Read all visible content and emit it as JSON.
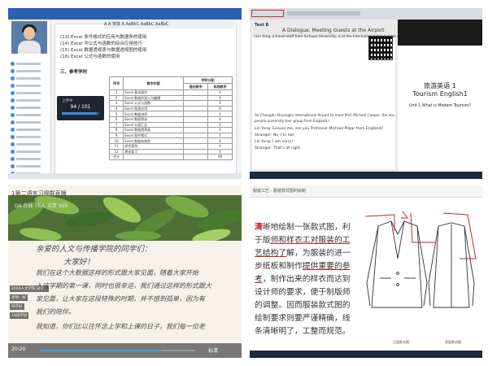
{
  "q1": {
    "ribbon": "A A 宋体 A AaBbC AaBbC AaBbC",
    "list": [
      "(13) Excel 条件格式的应用与数据条的使用",
      "(14) Excel 中公式与函数的综合应用技巧",
      "(15) Excel 数据透视表与数据透视图的使用",
      "(16) Excel 公式与函数的使用"
    ],
    "table_title": "三、参考学时",
    "table_headers": [
      "序号",
      "教学内容",
      "学时分配",
      "理论教学",
      "实践教学"
    ],
    "table_rows": [
      [
        "1",
        "Excel 基本操作",
        "",
        "4"
      ],
      [
        "2",
        "Excel 数据的录入与编辑",
        "",
        "4"
      ],
      [
        "3",
        "Excel 公式与函数",
        "",
        "4"
      ],
      [
        "4",
        "Excel 图表应用",
        "",
        "4"
      ],
      [
        "5",
        "Excel 数据排序",
        "",
        "4"
      ],
      [
        "6",
        "Excel 数据筛选",
        "",
        "4"
      ],
      [
        "7",
        "Excel 分类汇总",
        "",
        "4"
      ],
      [
        "8",
        "Excel 数据透视表",
        "",
        "4"
      ],
      [
        "9",
        "Excel 条件格式",
        "",
        "4"
      ],
      [
        "10",
        "Excel 数据有效性",
        "",
        "4"
      ],
      [
        "11",
        "综合案例",
        "",
        "4"
      ],
      [
        "12",
        "期末复习",
        "",
        "4"
      ]
    ],
    "table_total": [
      "合计",
      "",
      "",
      "48"
    ],
    "popup_title": "上传中",
    "popup_count": "94 / 101",
    "popup_progress": 0.93
  },
  "q2": {
    "unit": "Text B",
    "heading": "A Dialogue: Meeting Guests at the Airport",
    "intro": "(Lin Yong, a travel staff from Sichuan University, is at the International Arrival Gate of",
    "lines": [
      "Air Chengdu Shuangliu International Airport to meet Prof. Michael Cooper, the leader of an eight-",
      "people university tour group from England.)",
      "Lin Yong:    Excuse me, are you Professor Michael Pilgar from England?",
      "Stranger:    No, I'm not.",
      "Lin Yong:    I am sorry!",
      "Stranger:    That's all right."
    ],
    "slide_title_cn": "旅游英语 1",
    "slide_title_en": "Tourism English1",
    "slide_subtitle": "Unit 1 What is Modern Tourism?"
  },
  "q3": {
    "window_title": "1第二语言习得群直播",
    "live_label": "DA 在线 76人  点赞 999",
    "handwriting": [
      "亲爱的人文与传播学院的同学们：",
      "大家好！",
      "我们在这个大数据这样的形式跟大家见面，随着大家开始",
      "入这学期的第一课，同时也很幸运，我们通过这样的形式跟大",
      "家见面，让大家在这段特殊的时期，并不感到孤单，因为有",
      "我们的陪伴。",
      "我知道，你们比以往怀念上学和上课的日子，我们每一位老"
    ],
    "chat": [
      "2020人文学院 同学：",
      "老师：好",
      "同学好",
      "1A同学好"
    ],
    "time": "20:20",
    "progress": 0.78,
    "quality": "标清"
  },
  "q4": {
    "top_title": "服装工艺 - 服装款式图的绘制",
    "paragraph_first": "清",
    "paragraph_seg1": "晰地绘制一张款式图，利于版",
    "paragraph_seg2": "师和样衣工对服装的工艺结构了",
    "paragraph_seg3": "解，为服装的进一步纸板和制作",
    "paragraph_seg4": "提供重要的参考",
    "paragraph_seg5": "，制作出来的样衣而达到设计师的要求，便于制版师的调整。因而服装款式图的绘制要求则要严谨精确，线条清晰明了，工整而规范。",
    "label_front": "正面款式图",
    "label_back": "背面款式图"
  },
  "colors": {
    "accent_blue": "#2b5fb3",
    "mark_red": "#d02020"
  }
}
